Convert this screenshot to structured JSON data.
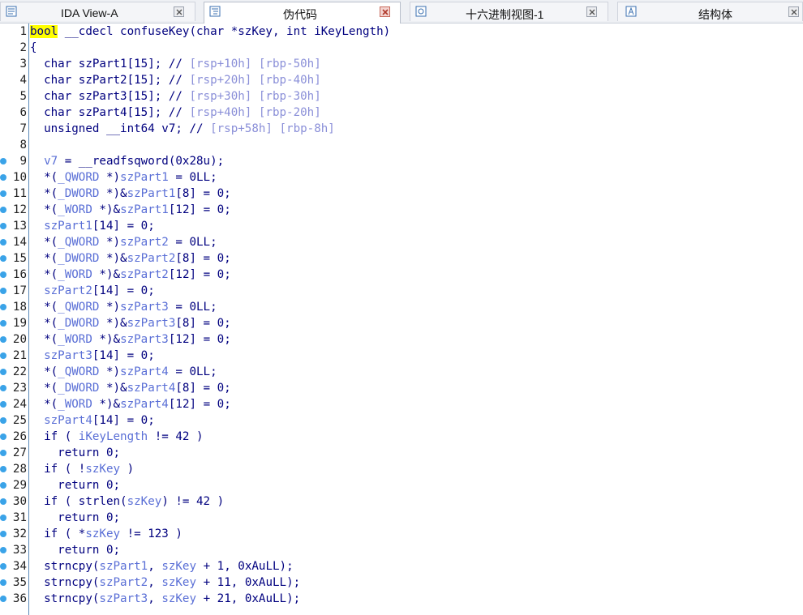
{
  "tabs": [
    {
      "label": "IDA View-A",
      "icon": "disassembly-view-icon",
      "active": false
    },
    {
      "label": "伪代码",
      "icon": "pseudocode-icon",
      "active": true
    },
    {
      "label": "十六进制视图-1",
      "icon": "hex-view-icon",
      "active": false
    },
    {
      "label": "结构体",
      "icon": "structures-icon",
      "active": false
    }
  ],
  "code": {
    "lines": [
      {
        "n": "1",
        "dot": false,
        "segs": [
          [
            "hl",
            "bool"
          ],
          [
            "p",
            " __cdecl confuseKey(char *szKey, int iKeyLength)"
          ]
        ]
      },
      {
        "n": "2",
        "dot": false,
        "segs": [
          [
            "p",
            "{"
          ]
        ]
      },
      {
        "n": "3",
        "dot": false,
        "segs": [
          [
            "p",
            "  char szPart1[15]; // "
          ],
          [
            "reg",
            "[rsp+10h] [rbp-50h]"
          ]
        ]
      },
      {
        "n": "4",
        "dot": false,
        "segs": [
          [
            "p",
            "  char szPart2[15]; // "
          ],
          [
            "reg",
            "[rsp+20h] [rbp-40h]"
          ]
        ]
      },
      {
        "n": "5",
        "dot": false,
        "segs": [
          [
            "p",
            "  char szPart3[15]; // "
          ],
          [
            "reg",
            "[rsp+30h] [rbp-30h]"
          ]
        ]
      },
      {
        "n": "6",
        "dot": false,
        "segs": [
          [
            "p",
            "  char szPart4[15]; // "
          ],
          [
            "reg",
            "[rsp+40h] [rbp-20h]"
          ]
        ]
      },
      {
        "n": "7",
        "dot": false,
        "segs": [
          [
            "p",
            "  unsigned __int64 v7; // "
          ],
          [
            "reg",
            "[rsp+58h] [rbp-8h]"
          ]
        ]
      },
      {
        "n": "8",
        "dot": false,
        "segs": [
          [
            "p",
            ""
          ]
        ]
      },
      {
        "n": "9",
        "dot": true,
        "segs": [
          [
            "p",
            "  "
          ],
          [
            "var",
            "v7"
          ],
          [
            "p",
            " = __readfsqword(0x28u);"
          ]
        ]
      },
      {
        "n": "10",
        "dot": true,
        "segs": [
          [
            "p",
            "  *("
          ],
          [
            "var",
            "_QWORD"
          ],
          [
            "p",
            " *)"
          ],
          [
            "var",
            "szPart1"
          ],
          [
            "p",
            " = 0LL;"
          ]
        ]
      },
      {
        "n": "11",
        "dot": true,
        "segs": [
          [
            "p",
            "  *("
          ],
          [
            "var",
            "_DWORD"
          ],
          [
            "p",
            " *)&"
          ],
          [
            "var",
            "szPart1"
          ],
          [
            "p",
            "[8] = 0;"
          ]
        ]
      },
      {
        "n": "12",
        "dot": true,
        "segs": [
          [
            "p",
            "  *("
          ],
          [
            "var",
            "_WORD"
          ],
          [
            "p",
            " *)&"
          ],
          [
            "var",
            "szPart1"
          ],
          [
            "p",
            "[12] = 0;"
          ]
        ]
      },
      {
        "n": "13",
        "dot": true,
        "segs": [
          [
            "p",
            "  "
          ],
          [
            "var",
            "szPart1"
          ],
          [
            "p",
            "[14] = 0;"
          ]
        ]
      },
      {
        "n": "14",
        "dot": true,
        "segs": [
          [
            "p",
            "  *("
          ],
          [
            "var",
            "_QWORD"
          ],
          [
            "p",
            " *)"
          ],
          [
            "var",
            "szPart2"
          ],
          [
            "p",
            " = 0LL;"
          ]
        ]
      },
      {
        "n": "15",
        "dot": true,
        "segs": [
          [
            "p",
            "  *("
          ],
          [
            "var",
            "_DWORD"
          ],
          [
            "p",
            " *)&"
          ],
          [
            "var",
            "szPart2"
          ],
          [
            "p",
            "[8] = 0;"
          ]
        ]
      },
      {
        "n": "16",
        "dot": true,
        "segs": [
          [
            "p",
            "  *("
          ],
          [
            "var",
            "_WORD"
          ],
          [
            "p",
            " *)&"
          ],
          [
            "var",
            "szPart2"
          ],
          [
            "p",
            "[12] = 0;"
          ]
        ]
      },
      {
        "n": "17",
        "dot": true,
        "segs": [
          [
            "p",
            "  "
          ],
          [
            "var",
            "szPart2"
          ],
          [
            "p",
            "[14] = 0;"
          ]
        ]
      },
      {
        "n": "18",
        "dot": true,
        "segs": [
          [
            "p",
            "  *("
          ],
          [
            "var",
            "_QWORD"
          ],
          [
            "p",
            " *)"
          ],
          [
            "var",
            "szPart3"
          ],
          [
            "p",
            " = 0LL;"
          ]
        ]
      },
      {
        "n": "19",
        "dot": true,
        "segs": [
          [
            "p",
            "  *("
          ],
          [
            "var",
            "_DWORD"
          ],
          [
            "p",
            " *)&"
          ],
          [
            "var",
            "szPart3"
          ],
          [
            "p",
            "[8] = 0;"
          ]
        ]
      },
      {
        "n": "20",
        "dot": true,
        "segs": [
          [
            "p",
            "  *("
          ],
          [
            "var",
            "_WORD"
          ],
          [
            "p",
            " *)&"
          ],
          [
            "var",
            "szPart3"
          ],
          [
            "p",
            "[12] = 0;"
          ]
        ]
      },
      {
        "n": "21",
        "dot": true,
        "segs": [
          [
            "p",
            "  "
          ],
          [
            "var",
            "szPart3"
          ],
          [
            "p",
            "[14] = 0;"
          ]
        ]
      },
      {
        "n": "22",
        "dot": true,
        "segs": [
          [
            "p",
            "  *("
          ],
          [
            "var",
            "_QWORD"
          ],
          [
            "p",
            " *)"
          ],
          [
            "var",
            "szPart4"
          ],
          [
            "p",
            " = 0LL;"
          ]
        ]
      },
      {
        "n": "23",
        "dot": true,
        "segs": [
          [
            "p",
            "  *("
          ],
          [
            "var",
            "_DWORD"
          ],
          [
            "p",
            " *)&"
          ],
          [
            "var",
            "szPart4"
          ],
          [
            "p",
            "[8] = 0;"
          ]
        ]
      },
      {
        "n": "24",
        "dot": true,
        "segs": [
          [
            "p",
            "  *("
          ],
          [
            "var",
            "_WORD"
          ],
          [
            "p",
            " *)&"
          ],
          [
            "var",
            "szPart4"
          ],
          [
            "p",
            "[12] = 0;"
          ]
        ]
      },
      {
        "n": "25",
        "dot": true,
        "segs": [
          [
            "p",
            "  "
          ],
          [
            "var",
            "szPart4"
          ],
          [
            "p",
            "[14] = 0;"
          ]
        ]
      },
      {
        "n": "26",
        "dot": true,
        "segs": [
          [
            "p",
            "  if ( "
          ],
          [
            "var",
            "iKeyLength"
          ],
          [
            "p",
            " != 42 )"
          ]
        ]
      },
      {
        "n": "27",
        "dot": true,
        "segs": [
          [
            "p",
            "    return 0;"
          ]
        ]
      },
      {
        "n": "28",
        "dot": true,
        "segs": [
          [
            "p",
            "  if ( !"
          ],
          [
            "var",
            "szKey"
          ],
          [
            "p",
            " )"
          ]
        ]
      },
      {
        "n": "29",
        "dot": true,
        "segs": [
          [
            "p",
            "    return 0;"
          ]
        ]
      },
      {
        "n": "30",
        "dot": true,
        "segs": [
          [
            "p",
            "  if ( strlen("
          ],
          [
            "var",
            "szKey"
          ],
          [
            "p",
            ") != 42 )"
          ]
        ]
      },
      {
        "n": "31",
        "dot": true,
        "segs": [
          [
            "p",
            "    return 0;"
          ]
        ]
      },
      {
        "n": "32",
        "dot": true,
        "segs": [
          [
            "p",
            "  if ( *"
          ],
          [
            "var",
            "szKey"
          ],
          [
            "p",
            " != 123 )"
          ]
        ]
      },
      {
        "n": "33",
        "dot": true,
        "segs": [
          [
            "p",
            "    return 0;"
          ]
        ]
      },
      {
        "n": "34",
        "dot": true,
        "segs": [
          [
            "p",
            "  strncpy("
          ],
          [
            "var",
            "szPart1"
          ],
          [
            "p",
            ", "
          ],
          [
            "var",
            "szKey"
          ],
          [
            "p",
            " + 1, 0xAuLL);"
          ]
        ]
      },
      {
        "n": "35",
        "dot": true,
        "segs": [
          [
            "p",
            "  strncpy("
          ],
          [
            "var",
            "szPart2"
          ],
          [
            "p",
            ", "
          ],
          [
            "var",
            "szKey"
          ],
          [
            "p",
            " + 11, 0xAuLL);"
          ]
        ]
      },
      {
        "n": "36",
        "dot": true,
        "segs": [
          [
            "p",
            "  strncpy("
          ],
          [
            "var",
            "szPart3"
          ],
          [
            "p",
            ", "
          ],
          [
            "var",
            "szKey"
          ],
          [
            "p",
            " + 21, 0xAuLL);"
          ]
        ]
      }
    ]
  }
}
